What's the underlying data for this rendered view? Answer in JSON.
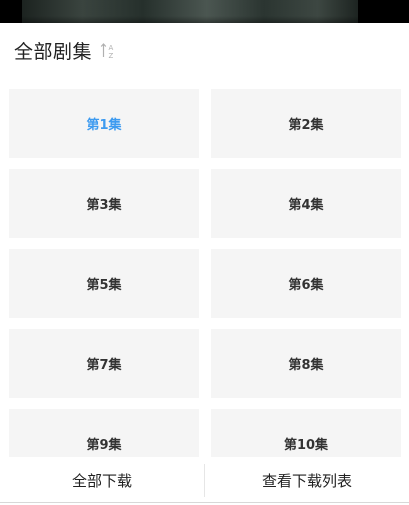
{
  "header": {
    "title": "全部剧集",
    "sort_icon": "sort-a-z-icon"
  },
  "episodes": [
    {
      "label": "第1集",
      "active": true
    },
    {
      "label": "第2集",
      "active": false
    },
    {
      "label": "第3集",
      "active": false
    },
    {
      "label": "第4集",
      "active": false
    },
    {
      "label": "第5集",
      "active": false
    },
    {
      "label": "第6集",
      "active": false
    },
    {
      "label": "第7集",
      "active": false
    },
    {
      "label": "第8集",
      "active": false
    },
    {
      "label": "第9集",
      "active": false
    },
    {
      "label": "第10集",
      "active": false
    }
  ],
  "bottom": {
    "download_all": "全部下载",
    "view_downloads": "查看下载列表"
  },
  "colors": {
    "active_episode": "#3d9bf0",
    "tile_bg": "#f5f5f5",
    "text": "#333333"
  }
}
